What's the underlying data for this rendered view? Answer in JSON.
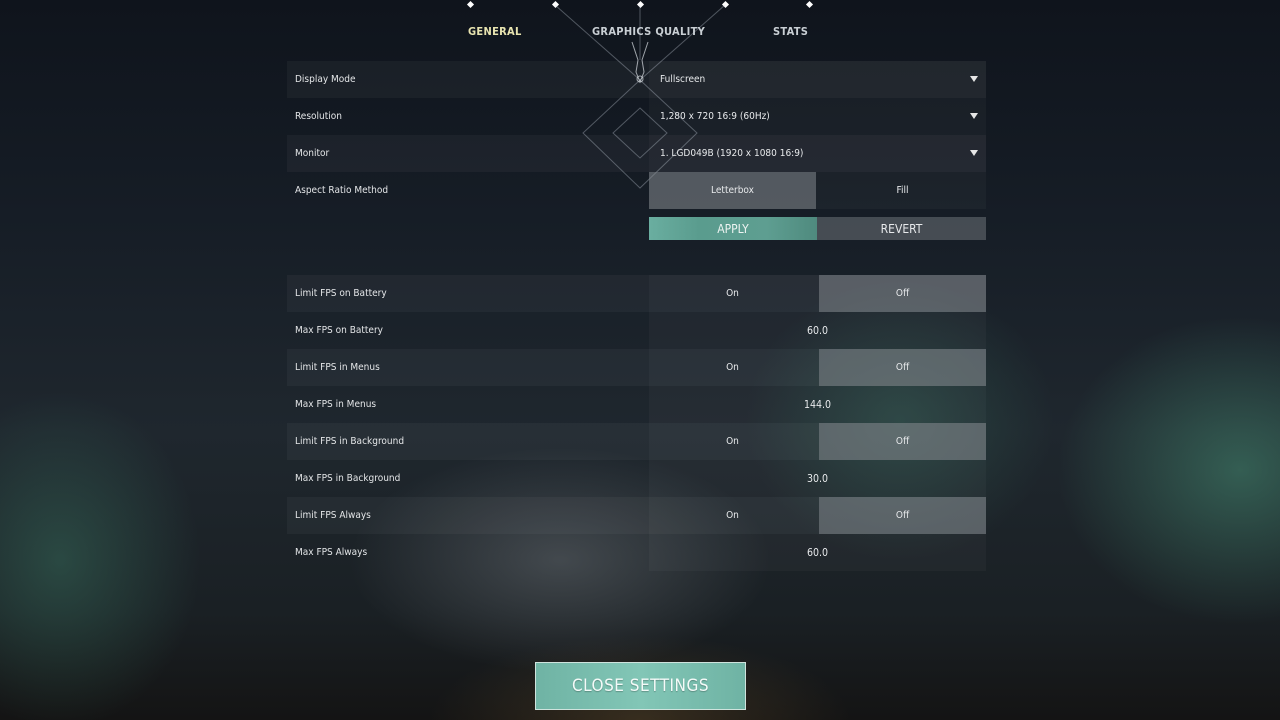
{
  "tabs": [
    {
      "label": "GENERAL",
      "active": true
    },
    {
      "label": "GRAPHICS QUALITY",
      "active": false
    },
    {
      "label": "STATS",
      "active": false
    }
  ],
  "display": {
    "display_mode": {
      "label": "Display Mode",
      "value": "Fullscreen"
    },
    "resolution": {
      "label": "Resolution",
      "value": "1,280 x 720 16:9 (60Hz)"
    },
    "monitor": {
      "label": "Monitor",
      "value": "1. LGD049B (1920 x  1080 16:9)"
    },
    "aspect_ratio": {
      "label": "Aspect Ratio Method",
      "options": [
        "Letterbox",
        "Fill"
      ],
      "selected": "Letterbox"
    }
  },
  "actions": {
    "apply": "APPLY",
    "revert": "REVERT"
  },
  "fps": {
    "on_label": "On",
    "off_label": "Off",
    "rows": [
      {
        "label": "Limit FPS on Battery",
        "selected": "Off"
      },
      {
        "label": "Max FPS on Battery",
        "value": "60.0"
      },
      {
        "label": "Limit FPS in Menus",
        "selected": "Off"
      },
      {
        "label": "Max FPS in Menus",
        "value": "144.0"
      },
      {
        "label": "Limit FPS in Background",
        "selected": "Off"
      },
      {
        "label": "Max FPS in Background",
        "value": "30.0"
      },
      {
        "label": "Limit FPS Always",
        "selected": "Off"
      },
      {
        "label": "Max FPS Always",
        "value": "60.0"
      }
    ]
  },
  "close_settings": "CLOSE SETTINGS",
  "colors": {
    "accent": "#6fb3a4",
    "active_tab": "#e8e4b0"
  }
}
